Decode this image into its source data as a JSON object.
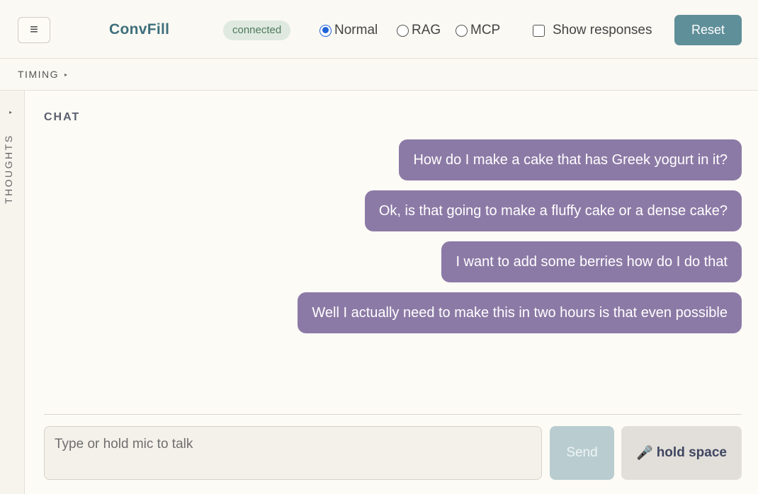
{
  "header": {
    "menu_icon": "hamburger-icon",
    "menu_glyph": "≡",
    "title": "ConvFill",
    "status": "connected",
    "modes": [
      {
        "label": "Normal",
        "checked": true
      },
      {
        "label": "RAG",
        "checked": false
      },
      {
        "label": "MCP",
        "checked": false
      }
    ],
    "show_responses_label": "Show responses",
    "show_responses_checked": false,
    "reset_label": "Reset"
  },
  "timing": {
    "label": "TIMING",
    "caret": "▸"
  },
  "thoughts": {
    "label": "THOUGHTS",
    "caret": "▸"
  },
  "chat": {
    "heading": "CHAT",
    "messages": [
      "How do I make a cake that has Greek yogurt in it?",
      "Ok, is that going to make a fluffy cake or a dense cake?",
      "I want to add some berries how do I do that",
      "Well I actually need to make this in two hours is that even possible"
    ],
    "input_placeholder": "Type or hold mic to talk",
    "input_value": "",
    "send_label": "Send",
    "mic_icon": "microphone-icon",
    "mic_glyph": "🎤",
    "mic_label": "hold space"
  },
  "colors": {
    "accent": "#5f8f99",
    "bubble": "#8c7aa6",
    "title": "#3f6f7d",
    "status_bg": "#dfe9e0"
  }
}
